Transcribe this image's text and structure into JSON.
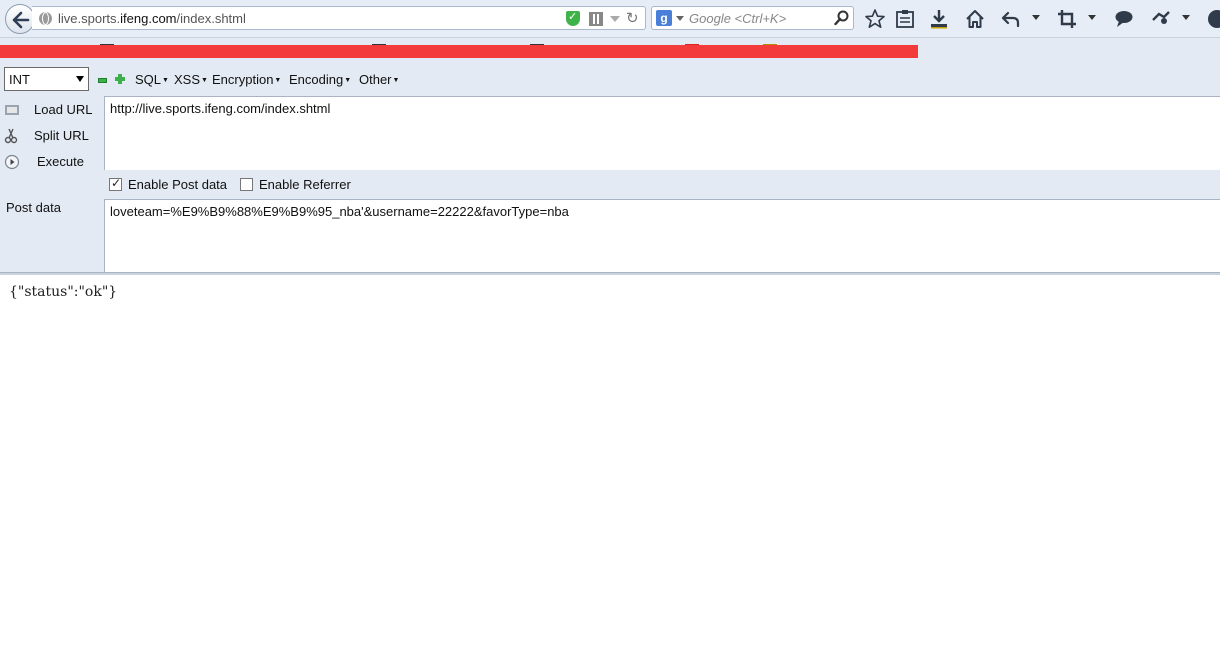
{
  "navbar": {
    "url_prefix": "live.sports.",
    "url_domain": "ifeng.com",
    "url_path": "/index.shtml",
    "search_engine_letter": "g",
    "search_placeholder": "Google <Ctrl+K>"
  },
  "hackbar": {
    "selected_option": "INT",
    "menus": [
      "SQL",
      "XSS",
      "Encryption",
      "Encoding",
      "Other"
    ],
    "actions": [
      "Load URL",
      "Split URL",
      "Execute"
    ],
    "url_value": "http://live.sports.ifeng.com/index.shtml",
    "enable_post_label": "Enable Post data",
    "enable_post_checked": true,
    "enable_referrer_label": "Enable Referrer",
    "enable_referrer_checked": false,
    "post_label": "Post data",
    "post_value": "loveteam=%E9%B9%88%E9%B9%95_nba'&username=22222&favorType=nba"
  },
  "page": {
    "response_text": "{\"status\":\"ok\"}"
  },
  "colors": {
    "toolbar_bg": "#e3eaf3",
    "redaction": "#f33b3b",
    "shield_green": "#3fb34a"
  }
}
